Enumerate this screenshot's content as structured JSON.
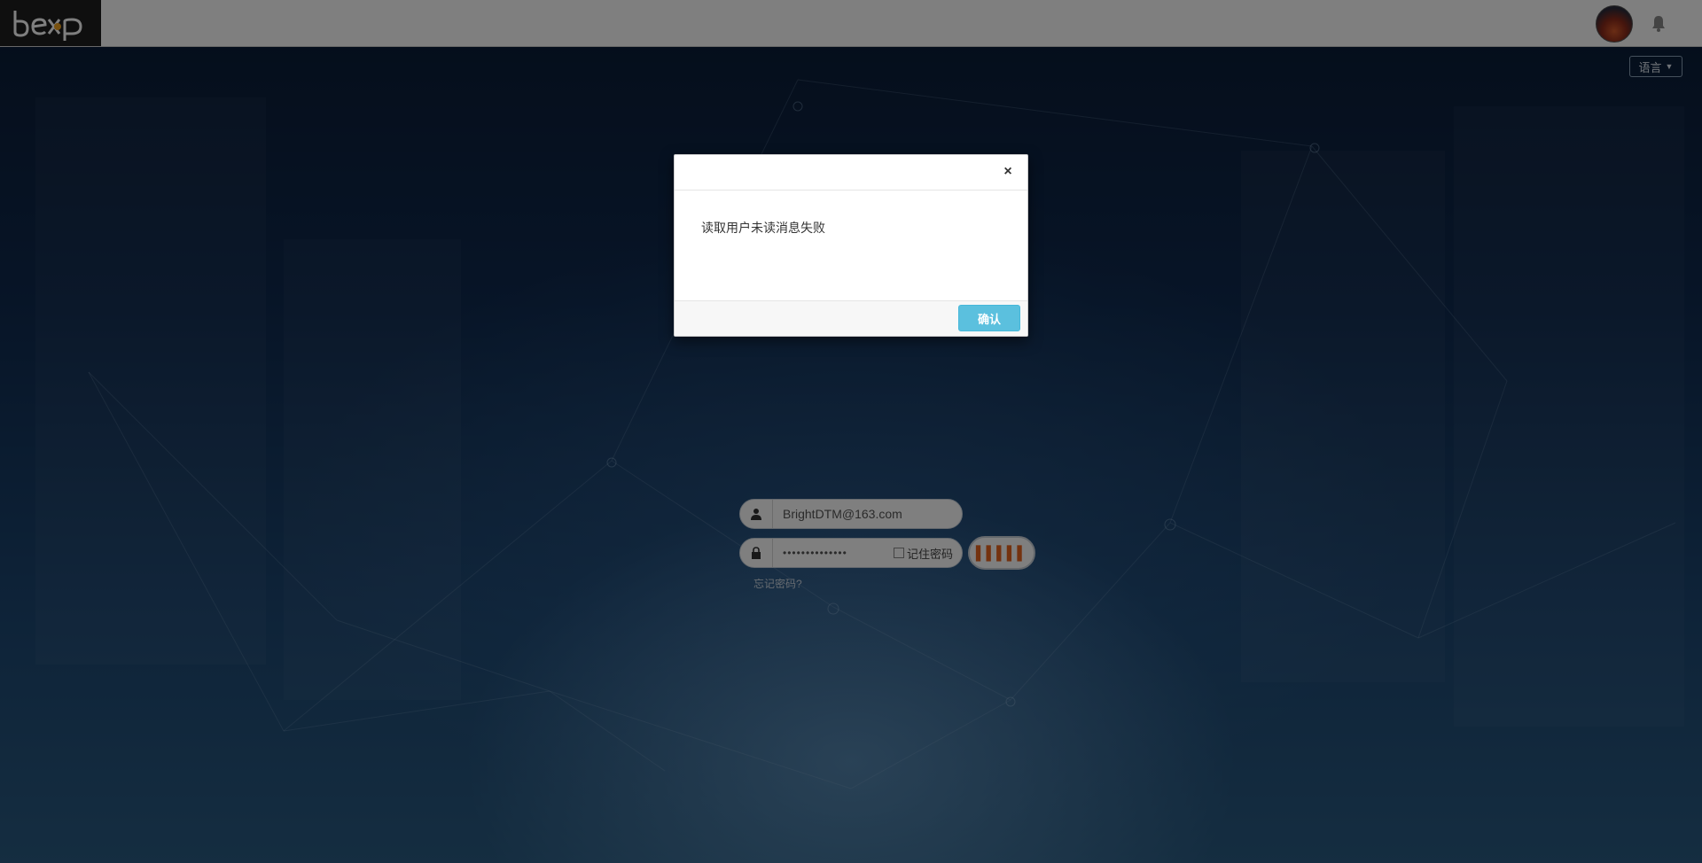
{
  "topbar": {
    "logo_text": "bexp",
    "bell_icon": "bell-icon",
    "avatar_icon": "user-avatar"
  },
  "language": {
    "label": "语言",
    "caret_icon": "caret-down-icon"
  },
  "login": {
    "username": "BrightDTM@163.com",
    "password_mask": "••••••••••••••",
    "remember_label": "记住密码",
    "login_button_label": "▌▌▌▌▌",
    "forgot_label": "忘记密码?",
    "user_icon": "user-icon",
    "lock_icon": "lock-icon"
  },
  "modal": {
    "close_label": "×",
    "message": "读取用户未读消息失败",
    "confirm_label": "确认"
  },
  "colors": {
    "confirm": "#5bc0de",
    "login_accent": "#e8641e"
  }
}
